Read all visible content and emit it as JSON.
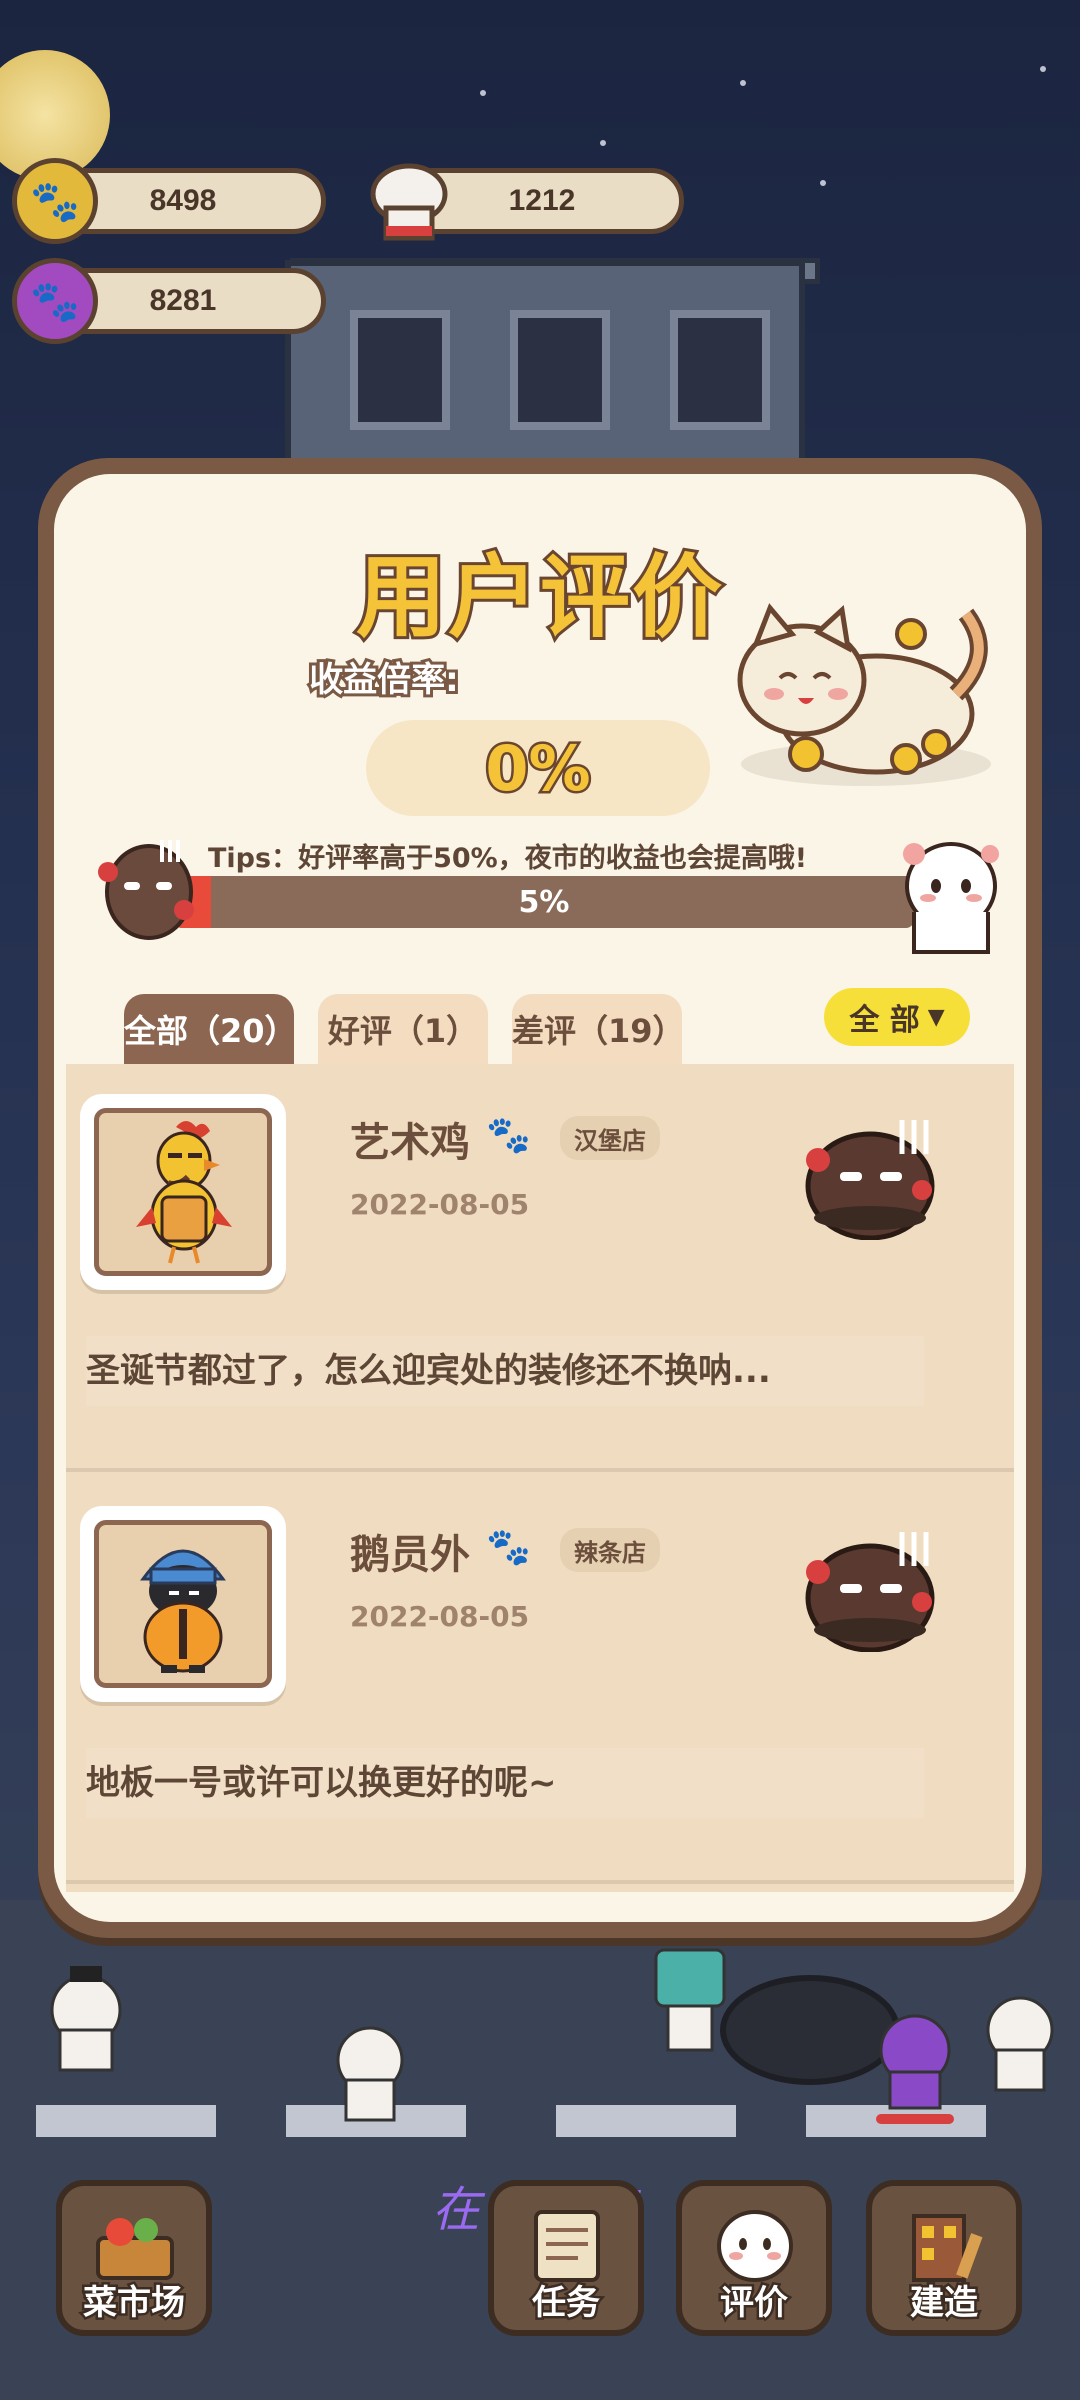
{
  "currency": {
    "paw_coins": "8498",
    "chef_tokens": "1212",
    "purple_paws": "8281"
  },
  "panel": {
    "title": "用户评价",
    "rate_label": "收益倍率:",
    "rate_value": "0%",
    "tips": "Tips：好评率高于50%，夜市的收益也会提高哦!",
    "progress_text": "5%",
    "progress_fraction": 0.05
  },
  "tabs": [
    {
      "label": "全部（20）",
      "active": true
    },
    {
      "label": "好评（1）",
      "active": false
    },
    {
      "label": "差评（19）",
      "active": false
    }
  ],
  "filter": {
    "label": "全 部",
    "icon": "triangle-down-icon"
  },
  "reviews": [
    {
      "name": "艺术鸡",
      "shop": "汉堡店",
      "date": "2022-08-05",
      "comment": "圣诞节都过了，怎么迎宾处的装修还不换呐...",
      "rating": "bad",
      "avatar": "rooster-icon"
    },
    {
      "name": "鹅员外",
      "shop": "辣条店",
      "date": "2022-08-05",
      "comment": "地板一号或许可以换更好的呢~",
      "rating": "bad",
      "avatar": "penguin-icon"
    }
  ],
  "nav": [
    {
      "label": "菜市场",
      "icon": "basket-icon"
    },
    {
      "label": "任务",
      "icon": "scroll-icon"
    },
    {
      "label": "评价",
      "icon": "ghost-face-icon"
    },
    {
      "label": "建造",
      "icon": "building-icon"
    }
  ],
  "now_playing": "在我身旁",
  "colors": {
    "title_yellow": "#f5c338",
    "panel_brown": "#7a5a44",
    "progress_red": "#e84b3a",
    "filter_yellow": "#f7df3a"
  }
}
